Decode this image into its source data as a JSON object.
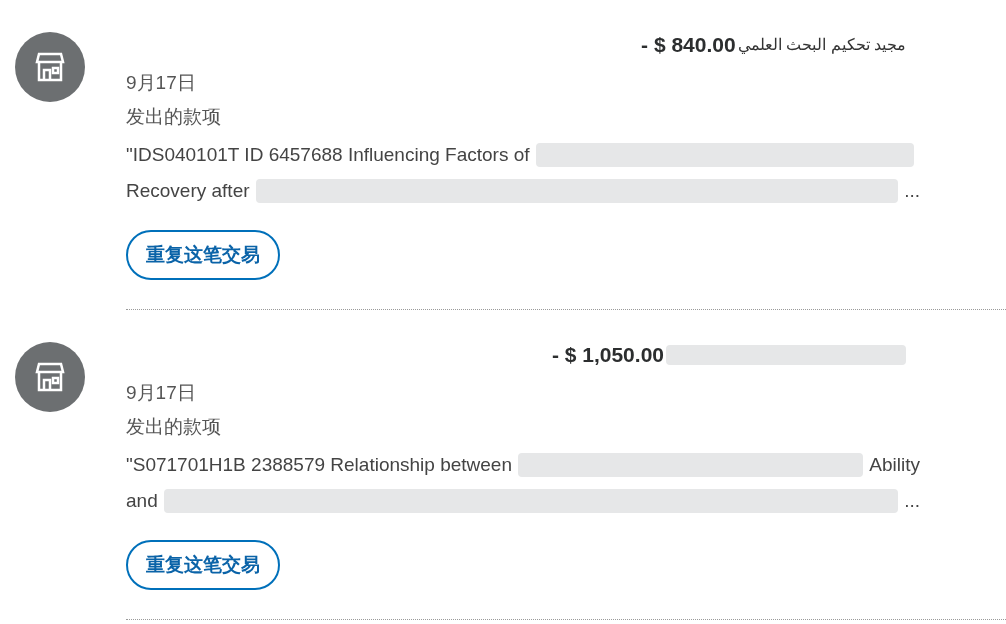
{
  "transactions": [
    {
      "amount": "- $ 840.00",
      "merchant": "مجيد تحكيم البحث العلمي",
      "date": "9月17日",
      "type": "发出的款项",
      "description_lines": [
        {
          "start": "\"IDS040101T ID 6457688 Influencing Factors of"
        },
        {
          "start": "Recovery after",
          "end": "..."
        }
      ],
      "action": "重复这笔交易"
    },
    {
      "amount": "- $ 1,050.00",
      "date": "9月17日",
      "type": "发出的款项",
      "description_lines": [
        {
          "start": "\"S071701H1B 2388579 Relationship between",
          "end": "Ability"
        },
        {
          "start": "and",
          "end": "..."
        }
      ],
      "action": "重复这笔交易"
    }
  ]
}
